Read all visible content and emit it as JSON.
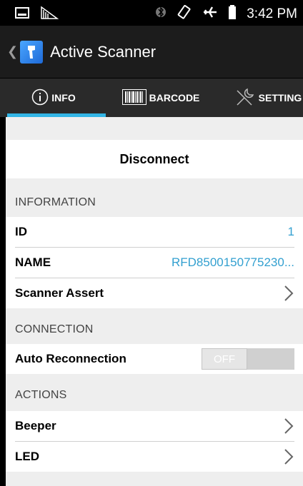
{
  "status_bar": {
    "time": "3:42 PM"
  },
  "app": {
    "title": "Active Scanner"
  },
  "tabs": [
    {
      "label": "INFO",
      "icon": "info-icon"
    },
    {
      "label": "BARCODE",
      "icon": "barcode-icon"
    },
    {
      "label": "SETTING",
      "icon": "wrench-icon"
    }
  ],
  "content": {
    "disconnect_label": "Disconnect",
    "information": {
      "header": "INFORMATION",
      "id_label": "ID",
      "id_value": "1",
      "name_label": "NAME",
      "name_value": "RFD8500150775230...",
      "scanner_assert_label": "Scanner Assert"
    },
    "connection": {
      "header": "CONNECTION",
      "auto_reconnect_label": "Auto Reconnection",
      "toggle_state": "OFF"
    },
    "actions": {
      "header": "ACTIONS",
      "beeper_label": "Beeper",
      "led_label": "LED"
    }
  },
  "colors": {
    "accent": "#33b5e5",
    "value_text": "#33a0d0"
  }
}
